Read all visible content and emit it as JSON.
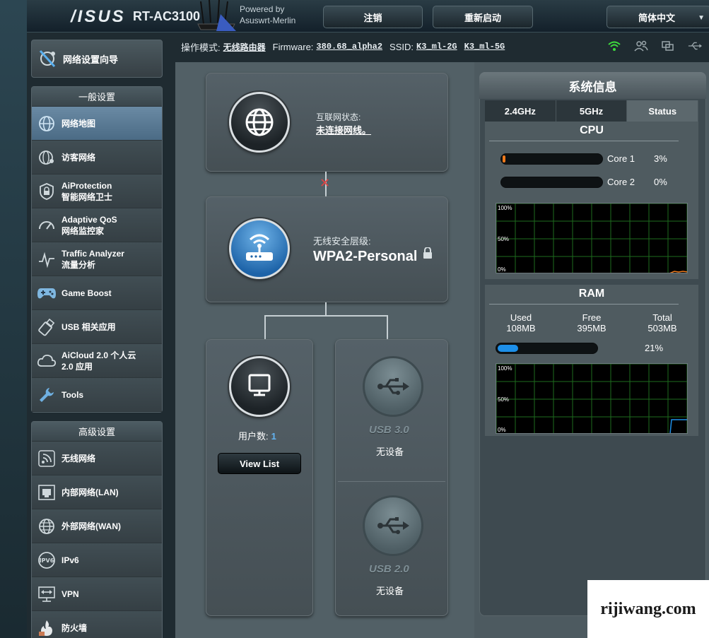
{
  "header": {
    "brand": "/ISUS",
    "model": "RT-AC3100",
    "powered_line1": "Powered by",
    "powered_line2": "Asuswrt-Merlin",
    "logout_label": "注销",
    "reboot_label": "重新启动",
    "language": "简体中文"
  },
  "statusbar": {
    "mode_label": "操作模式:",
    "mode_value": "无线路由器",
    "firmware_label": "Firmware:",
    "firmware_value": "380.68_alpha2",
    "ssid_label": "SSID:",
    "ssid_2g": "K3_ml-2G",
    "ssid_5g": "K3_ml-5G",
    "icons": [
      "wifi-icon",
      "clients-icon",
      "network-icon",
      "usb-icon"
    ]
  },
  "nav": {
    "wizard_label": "网络设置向导",
    "general_title": "一般设置",
    "general_items": [
      {
        "line1": "网络地图",
        "line2": "",
        "icon": "globe-icon"
      },
      {
        "line1": "访客网络",
        "line2": "",
        "icon": "guest-network-icon"
      },
      {
        "line1": "AiProtection",
        "line2": "智能网络卫士",
        "icon": "shield-icon"
      },
      {
        "line1": "Adaptive QoS",
        "line2": "网络监控家",
        "icon": "gauge-icon"
      },
      {
        "line1": "Traffic Analyzer",
        "line2": "流量分析",
        "icon": "traffic-icon"
      },
      {
        "line1": "Game Boost",
        "line2": "",
        "icon": "gamepad-icon"
      },
      {
        "line1": "USB 相关应用",
        "line2": "",
        "icon": "usb-stick-icon"
      },
      {
        "line1": "AiCloud 2.0 个人云",
        "line2": "2.0 应用",
        "icon": "cloud-icon"
      },
      {
        "line1": "Tools",
        "line2": "",
        "icon": "wrench-icon"
      }
    ],
    "advanced_title": "高级设置",
    "advanced_items": [
      {
        "line1": "无线网络",
        "line2": "",
        "icon": "wireless-icon"
      },
      {
        "line1": "内部网络(LAN)",
        "line2": "",
        "icon": "lan-icon"
      },
      {
        "line1": "外部网络(WAN)",
        "line2": "",
        "icon": "wan-globe-icon"
      },
      {
        "line1": "IPv6",
        "line2": "",
        "icon": "ipv6-icon"
      },
      {
        "line1": "VPN",
        "line2": "",
        "icon": "vpn-icon"
      },
      {
        "line1": "防火墙",
        "line2": "",
        "icon": "firewall-icon"
      }
    ]
  },
  "map": {
    "internet_label": "互联网状态:",
    "internet_status": "未连接网线。",
    "wireless_label": "无线安全层级:",
    "wireless_value": "WPA2-Personal",
    "clients_label": "用户数:",
    "clients_count": "1",
    "view_list": "View List",
    "usb3_label": "USB 3.0",
    "usb3_status": "无设备",
    "usb2_label": "USB 2.0",
    "usb2_status": "无设备"
  },
  "sysinfo": {
    "title": "系统信息",
    "tabs": [
      "2.4GHz",
      "5GHz",
      "Status"
    ],
    "active_tab": "Status",
    "cpu_title": "CPU",
    "cores": [
      {
        "name": "Core 1",
        "percent": "3%",
        "value": 3,
        "color": "#f07a1a"
      },
      {
        "name": "Core 2",
        "percent": "0%",
        "value": 0,
        "color": "#f07a1a"
      }
    ],
    "cpu_graph_labels": [
      "100%",
      "50%",
      "0%"
    ],
    "ram_title": "RAM",
    "ram_used_label": "Used",
    "ram_used": "108MB",
    "ram_free_label": "Free",
    "ram_free": "395MB",
    "ram_total_label": "Total",
    "ram_total": "503MB",
    "ram_percent": "21%",
    "ram_value": 21,
    "ram_color": "#1d8fe8",
    "ram_graph_labels": [
      "100%",
      "50%",
      "0%"
    ]
  },
  "watermark": "rijiwang.com"
}
